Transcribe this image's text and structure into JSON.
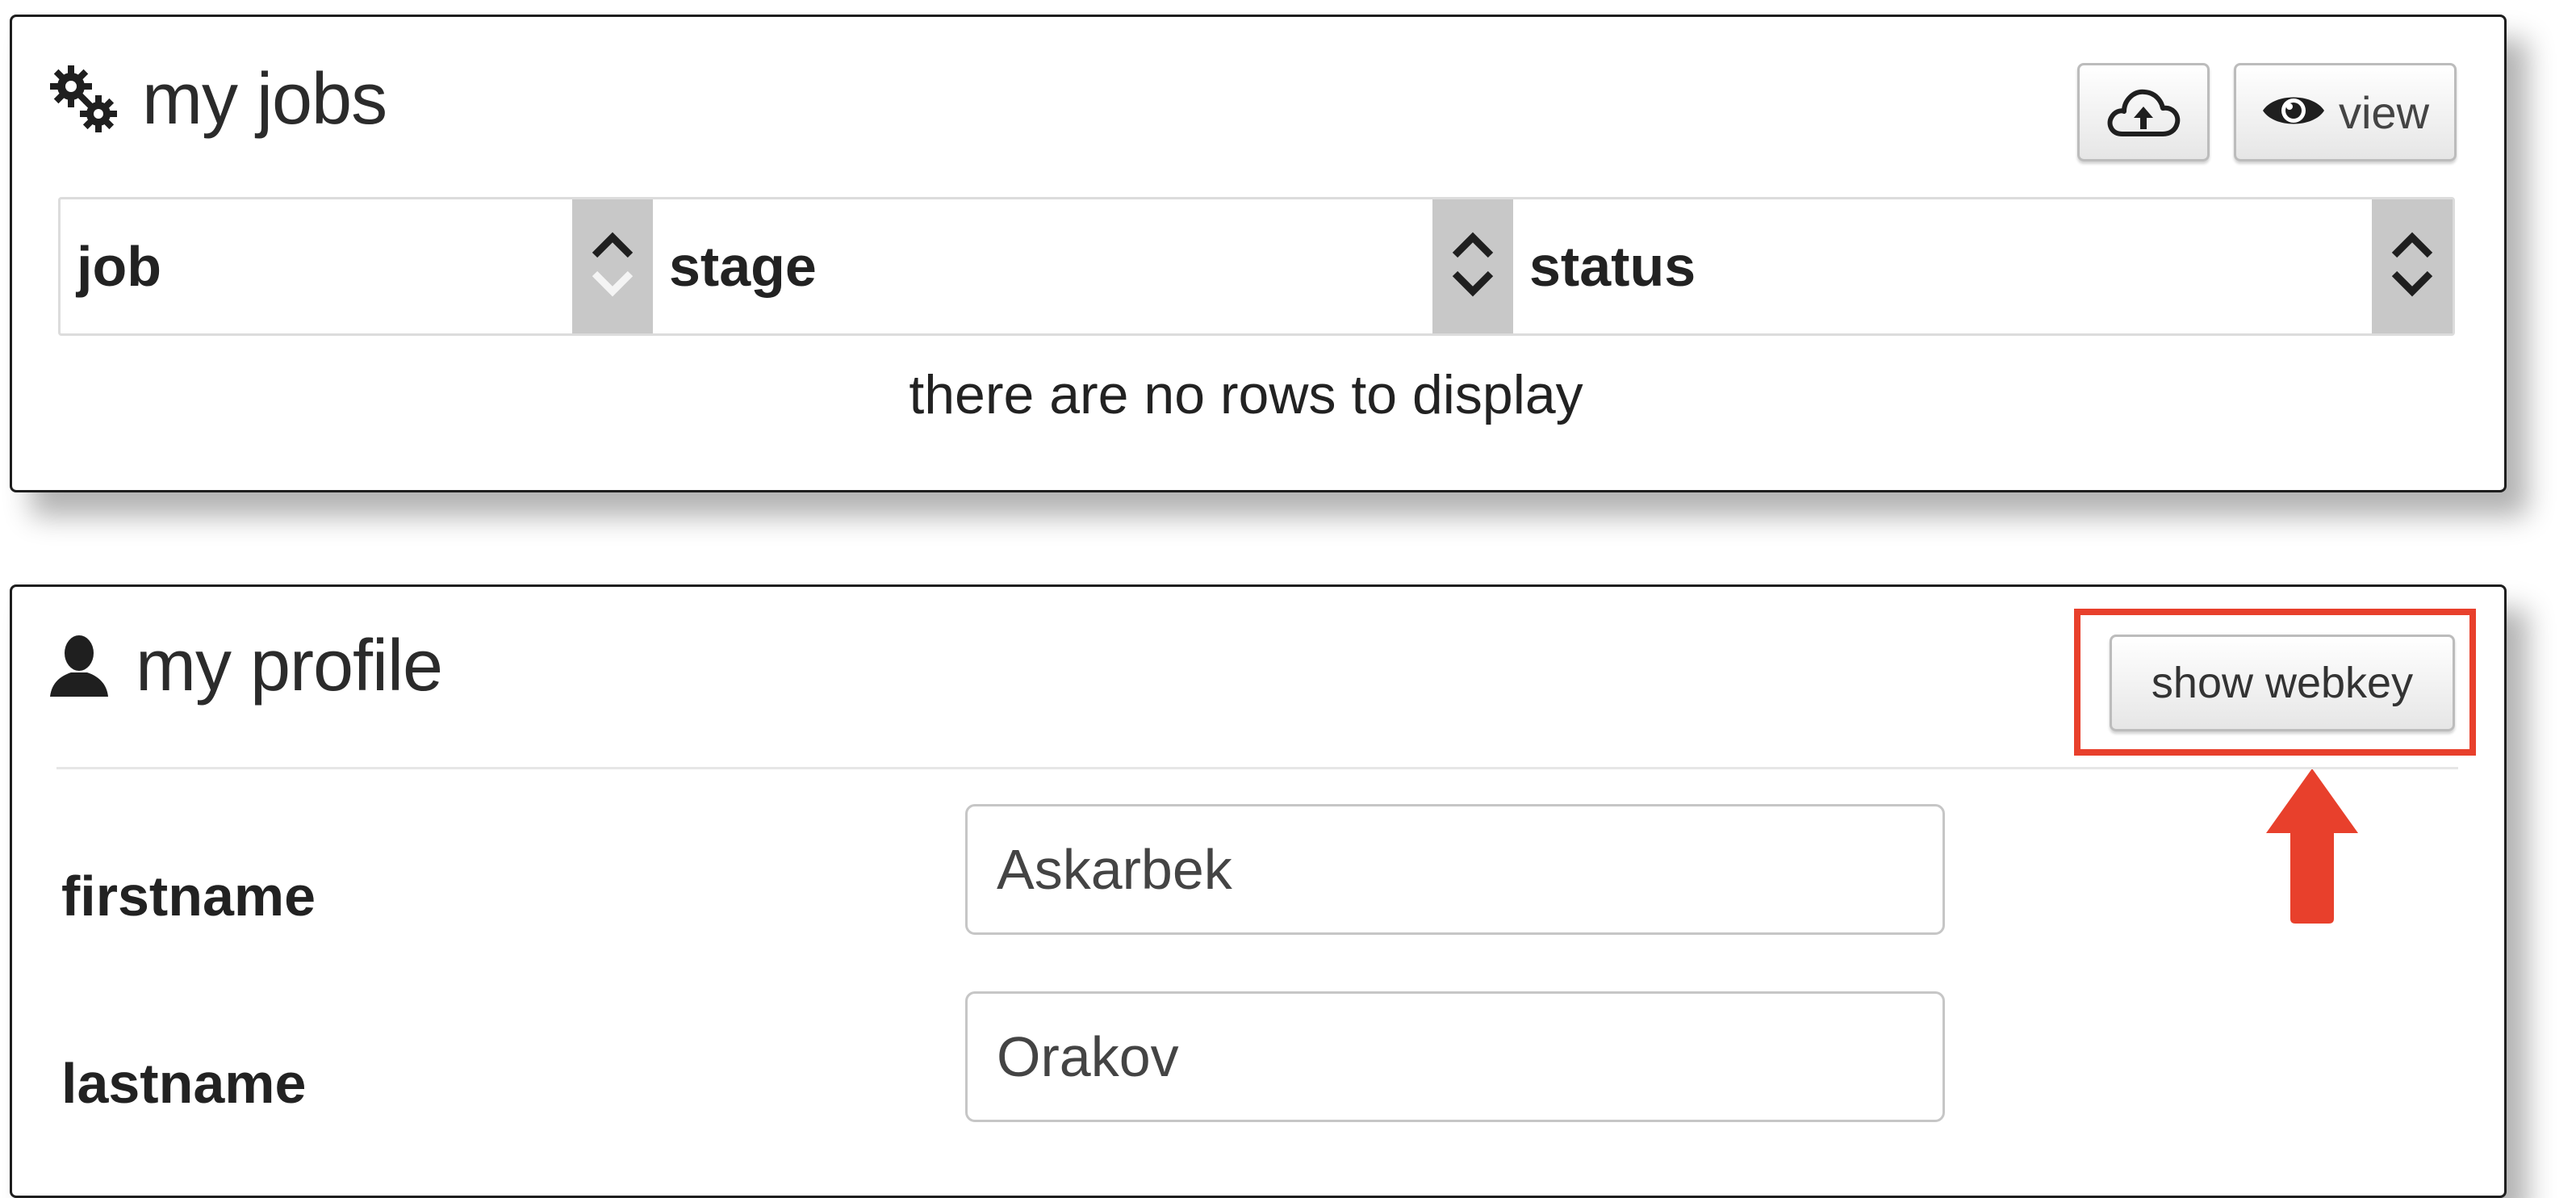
{
  "jobs": {
    "title": "my jobs",
    "icon": "cogs-icon",
    "upload_icon": "cloud-upload-icon",
    "view_label": "view",
    "view_icon": "eye-icon",
    "table": {
      "columns": [
        {
          "label": "job",
          "sort": "ascending"
        },
        {
          "label": "stage",
          "sort": "none"
        },
        {
          "label": "status",
          "sort": "none"
        }
      ],
      "empty_message": "there are no rows to display"
    }
  },
  "profile": {
    "title": "my profile",
    "icon": "user-icon",
    "webkey_button_label": "show webkey",
    "highlight_color": "#e8402c",
    "fields": [
      {
        "label": "firstname",
        "value": "Askarbek"
      },
      {
        "label": "lastname",
        "value": "Orakov"
      }
    ]
  }
}
